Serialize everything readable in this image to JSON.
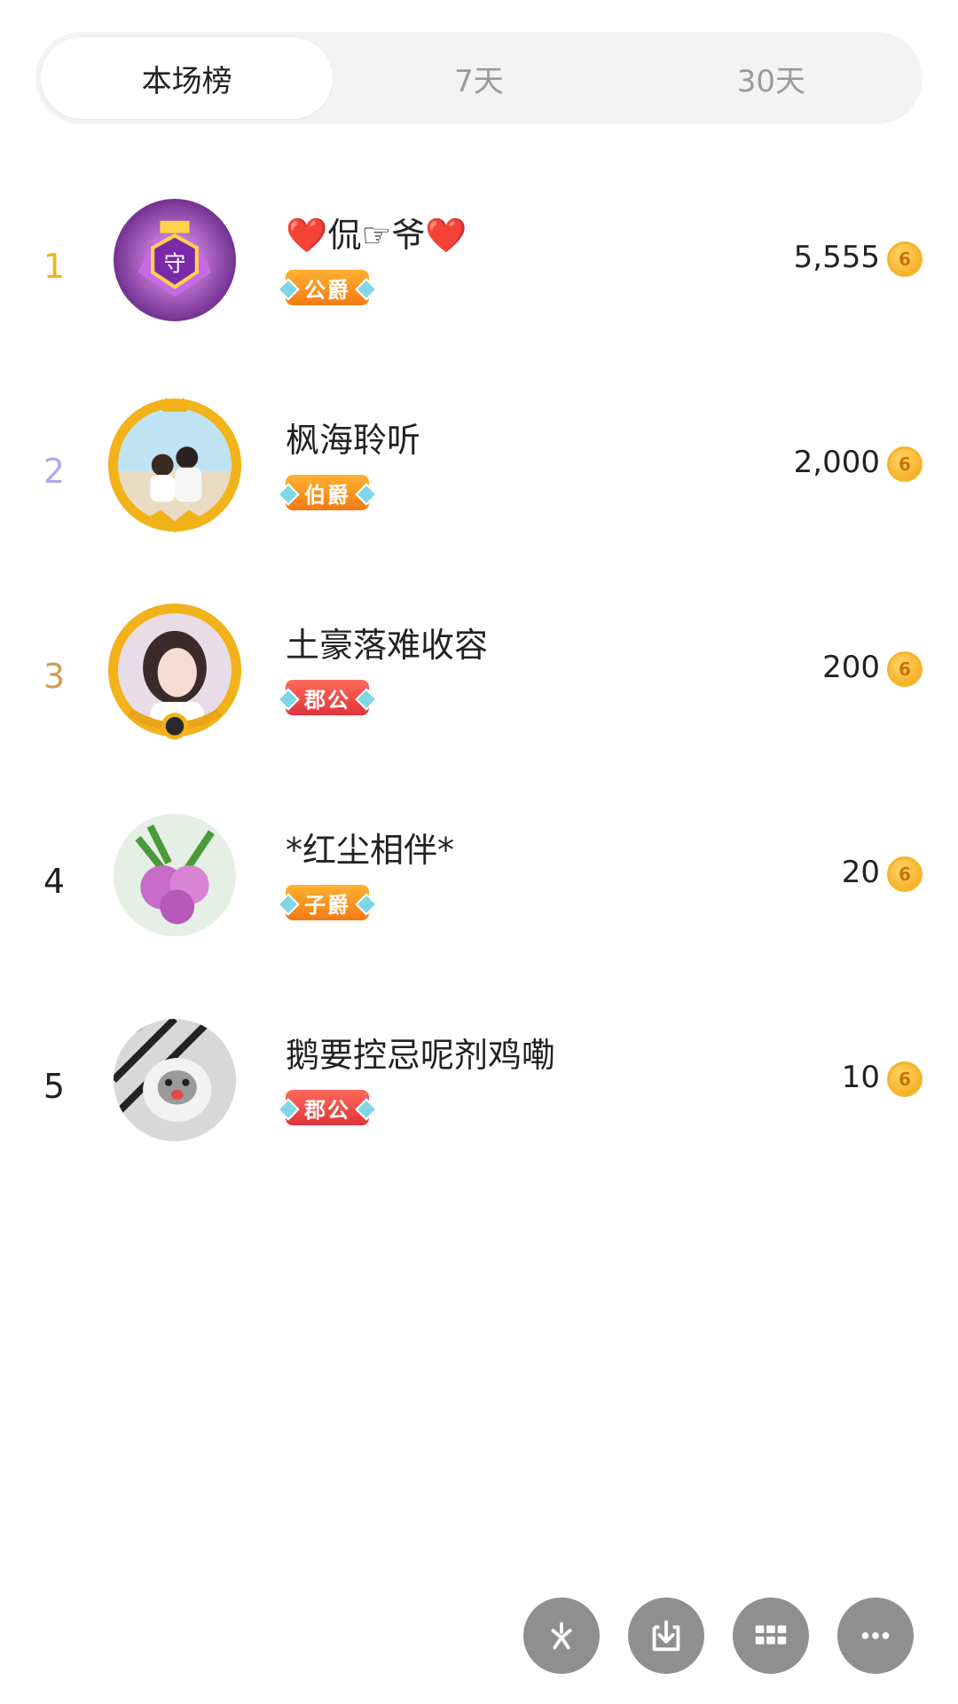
{
  "tabs": [
    {
      "label": "本场榜",
      "active": true
    },
    {
      "label": "7天",
      "active": false
    },
    {
      "label": "30天",
      "active": false
    }
  ],
  "ranking": [
    {
      "rank": "1",
      "rank_color": "#f2b21a",
      "name": "❤️侃☞爷❤️",
      "badge": "公爵",
      "badge_style": "orange",
      "score": "5,555"
    },
    {
      "rank": "2",
      "rank_color": "#b3a8e8",
      "name": "枫海聆听",
      "badge": "伯爵",
      "badge_style": "orange",
      "score": "2,000"
    },
    {
      "rank": "3",
      "rank_color": "#d49b52",
      "name": "土豪落难收容",
      "badge": "郡公",
      "badge_style": "red",
      "score": "200"
    },
    {
      "rank": "4",
      "rank_color": "#222222",
      "name": "*红尘相伴*",
      "badge": "子爵",
      "badge_style": "orange",
      "score": "20"
    },
    {
      "rank": "5",
      "rank_color": "#222222",
      "name": "鹅要控忌呢剂鸡嘞",
      "badge": "郡公",
      "badge_style": "red",
      "score": "10"
    }
  ],
  "coin_symbol": "6",
  "coin_icon": "coin-icon",
  "actions": [
    {
      "icon": "pinwheel-icon"
    },
    {
      "icon": "download-icon"
    },
    {
      "icon": "grid-icon"
    },
    {
      "icon": "more-icon"
    }
  ]
}
